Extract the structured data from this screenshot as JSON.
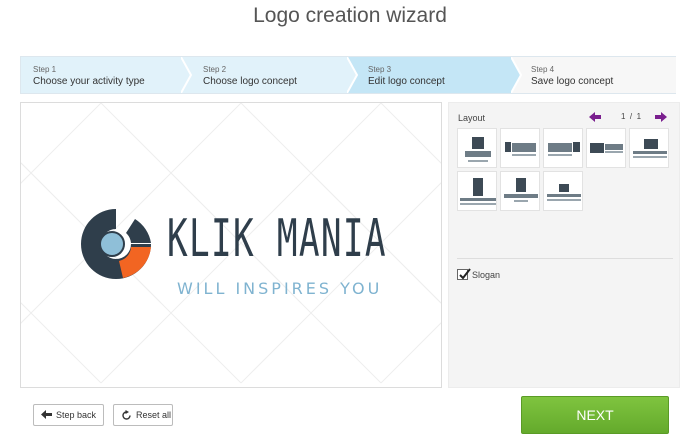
{
  "page_title": "Logo creation wizard",
  "steps": [
    {
      "num": "Step 1",
      "label": "Choose your activity type"
    },
    {
      "num": "Step 2",
      "label": "Choose logo concept"
    },
    {
      "num": "Step 3",
      "label": "Edit logo concept"
    },
    {
      "num": "Step 4",
      "label": "Save logo concept"
    }
  ],
  "active_step": 3,
  "preview": {
    "logo_name": "KLIK MANIA",
    "logo_slogan": "WILL INSPIRES YOU",
    "colors": {
      "name": "#2f3e4b",
      "slogan": "#7fb3d0",
      "accent": "#f26522",
      "light": "#8fbfd8"
    }
  },
  "layout_panel": {
    "label": "Layout",
    "page_current": "1",
    "page_separator": "/",
    "page_total": "1",
    "slogan_label": "Slogan",
    "slogan_checked": true
  },
  "buttons": {
    "step_back": "Step back",
    "reset_all": "Reset all",
    "next": "NEXT"
  },
  "colors": {
    "next_green": "#6db333",
    "step_active": "#c4e6f6",
    "step_done": "#e1f2fa",
    "pager_arrow": "#7a1f8e"
  }
}
